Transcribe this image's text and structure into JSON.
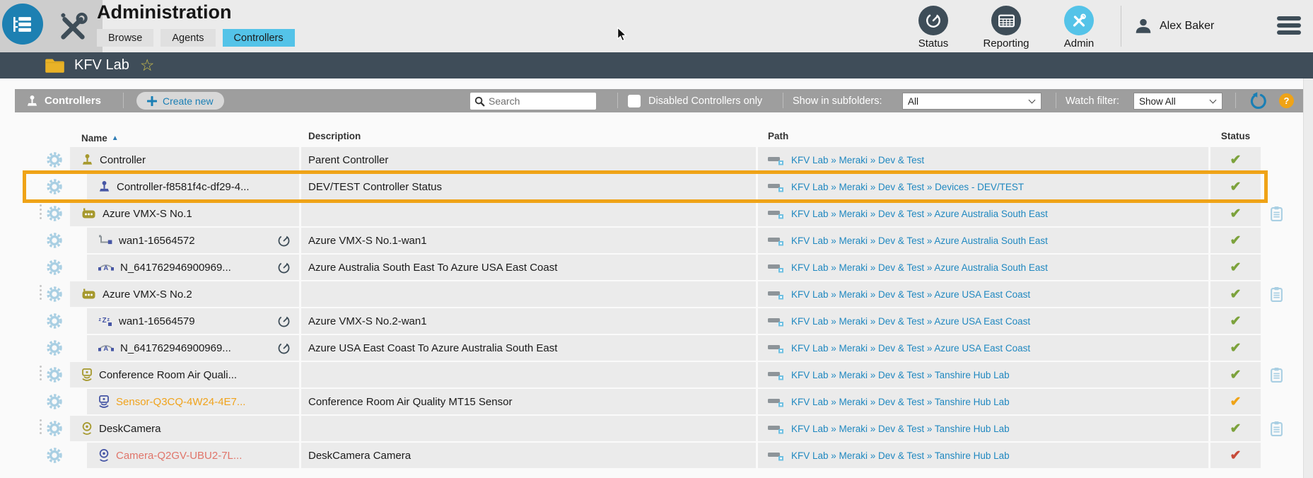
{
  "header": {
    "title": "Administration",
    "tabs": [
      {
        "label": "Browse",
        "active": false
      },
      {
        "label": "Agents",
        "active": false
      },
      {
        "label": "Controllers",
        "active": true
      }
    ],
    "nav": [
      {
        "label": "Status",
        "active": false
      },
      {
        "label": "Reporting",
        "active": false
      },
      {
        "label": "Admin",
        "active": true
      }
    ],
    "user_name": "Alex Baker"
  },
  "breadcrumb": {
    "location": "KFV Lab",
    "favorite_icon": "☆"
  },
  "toolbar": {
    "section_label": "Controllers",
    "create_label": "Create new",
    "search_placeholder": "Search",
    "checkbox_label": "Disabled Controllers only",
    "subfolders_label": "Show in subfolders:",
    "subfolders_value": "All",
    "watch_label": "Watch filter:",
    "watch_value": "Show All",
    "help_label": "?"
  },
  "table": {
    "sort_icon": "▲",
    "columns": {
      "name": "Name",
      "description": "Description",
      "path": "Path",
      "status": "Status"
    },
    "rows": [
      {
        "name": "Controller",
        "icon": "controller",
        "icon_tint": "olive",
        "name_color": "default",
        "description": "Parent Controller",
        "path": "KFV Lab » Meraki » Dev & Test",
        "status": "up",
        "child": false,
        "group": false,
        "watched": false,
        "highlighted": false
      },
      {
        "name": "Controller-f8581f4c-df29-4...",
        "icon": "controller",
        "icon_tint": "indigo",
        "name_color": "default",
        "description": "DEV/TEST Controller Status",
        "path": "KFV Lab » Meraki » Dev & Test » Devices - DEV/TEST",
        "status": "up",
        "child": true,
        "group": false,
        "watched": false,
        "highlighted": true
      },
      {
        "name": "Azure VMX-S No.1",
        "icon": "agent",
        "icon_tint": "olive",
        "name_color": "default",
        "description": "",
        "path": "KFV Lab » Meraki » Dev & Test » Azure Australia South East",
        "status": "up",
        "child": false,
        "group": true,
        "watched": false,
        "highlighted": false
      },
      {
        "name": "wan1-16564572",
        "icon": "wan",
        "icon_tint": "indigo",
        "name_color": "default",
        "description": "Azure VMX-S No.1-wan1",
        "path": "KFV Lab » Meraki » Dev & Test » Azure Australia South East",
        "status": "up",
        "child": true,
        "group": false,
        "watched": true,
        "highlighted": false
      },
      {
        "name": "N_641762946900969...",
        "icon": "vpn",
        "icon_tint": "indigo",
        "name_color": "default",
        "description": "Azure Australia South East To Azure USA East Coast",
        "path": "KFV Lab » Meraki » Dev & Test » Azure Australia South East",
        "status": "up",
        "child": true,
        "group": false,
        "watched": true,
        "highlighted": false
      },
      {
        "name": "Azure VMX-S No.2",
        "icon": "agent",
        "icon_tint": "olive",
        "name_color": "default",
        "description": "",
        "path": "KFV Lab » Meraki » Dev & Test » Azure USA East Coast",
        "status": "up",
        "child": false,
        "group": true,
        "watched": false,
        "highlighted": false
      },
      {
        "name": "wan1-16564579",
        "icon": "sleep",
        "icon_tint": "indigo",
        "name_color": "default",
        "description": "Azure VMX-S No.2-wan1",
        "path": "KFV Lab » Meraki » Dev & Test » Azure USA East Coast",
        "status": "up",
        "child": true,
        "group": false,
        "watched": true,
        "highlighted": false
      },
      {
        "name": "N_641762946900969...",
        "icon": "vpn",
        "icon_tint": "indigo",
        "name_color": "default",
        "description": "Azure USA East Coast To Azure Australia South East",
        "path": "KFV Lab » Meraki » Dev & Test » Azure USA East Coast",
        "status": "up",
        "child": true,
        "group": false,
        "watched": true,
        "highlighted": false
      },
      {
        "name": "Conference Room Air Quali...",
        "icon": "sensor",
        "icon_tint": "olive",
        "name_color": "default",
        "description": "",
        "path": "KFV Lab » Meraki » Dev & Test » Tanshire Hub Lab",
        "status": "up",
        "child": false,
        "group": true,
        "watched": false,
        "highlighted": false
      },
      {
        "name": "Sensor-Q3CQ-4W24-4E7...",
        "icon": "sensor",
        "icon_tint": "indigo",
        "name_color": "orange",
        "description": "Conference Room Air Quality MT15 Sensor",
        "path": "KFV Lab » Meraki » Dev & Test » Tanshire Hub Lab",
        "status": "warning",
        "child": true,
        "group": false,
        "watched": false,
        "highlighted": false
      },
      {
        "name": "DeskCamera",
        "icon": "camera",
        "icon_tint": "olive",
        "name_color": "default",
        "description": "",
        "path": "KFV Lab » Meraki » Dev & Test » Tanshire Hub Lab",
        "status": "up",
        "child": false,
        "group": true,
        "watched": false,
        "highlighted": false
      },
      {
        "name": "Camera-Q2GV-UBU2-7L...",
        "icon": "camera",
        "icon_tint": "indigo",
        "name_color": "salmon",
        "description": "DeskCamera Camera",
        "path": "KFV Lab » Meraki » Dev & Test » Tanshire Hub Lab",
        "status": "down",
        "child": true,
        "group": false,
        "watched": false,
        "highlighted": false
      }
    ]
  },
  "colors": {
    "accent_blue": "#1a7fb5",
    "active_tab_blue": "#54c3e8",
    "highlight_orange": "#efa317",
    "status_up_green": "#7ca23c",
    "status_warning_orange": "#efa317",
    "status_down_red": "#c74b39",
    "link_blue": "#2088c0",
    "name_orange": "#f0a31c",
    "name_salmon": "#e0756a",
    "icon_olive": "#a6992e",
    "icon_indigo": "#4656a5",
    "slate": "#3e4d58"
  }
}
